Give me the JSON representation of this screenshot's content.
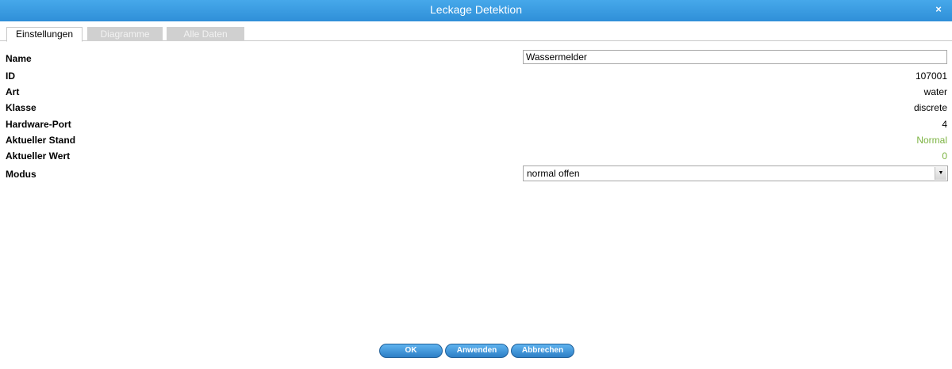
{
  "window": {
    "title": "Leckage Detektion",
    "close_glyph": "×"
  },
  "tabs": [
    {
      "label": "Einstellungen",
      "active": true
    },
    {
      "label": "Diagramme",
      "active": false
    },
    {
      "label": "Alle Daten",
      "active": false
    }
  ],
  "fields": {
    "name": {
      "label": "Name",
      "value": "Wassermelder"
    },
    "id": {
      "label": "ID",
      "value": "107001"
    },
    "art": {
      "label": "Art",
      "value": "water"
    },
    "klasse": {
      "label": "Klasse",
      "value": "discrete"
    },
    "hardware_port": {
      "label": "Hardware-Port",
      "value": "4"
    },
    "aktueller_stand": {
      "label": "Aktueller Stand",
      "value": "Normal"
    },
    "aktueller_wert": {
      "label": "Aktueller Wert",
      "value": "0"
    },
    "modus": {
      "label": "Modus",
      "value": "normal offen"
    }
  },
  "buttons": {
    "ok": "OK",
    "apply": "Anwenden",
    "cancel": "Abbrechen"
  },
  "colors": {
    "titlebar": "#3a9be2",
    "status_green": "#7cb342",
    "button_blue": "#2d7fc6"
  },
  "icons": {
    "close": "close-icon",
    "select_arrow": "chevron-down-icon"
  }
}
